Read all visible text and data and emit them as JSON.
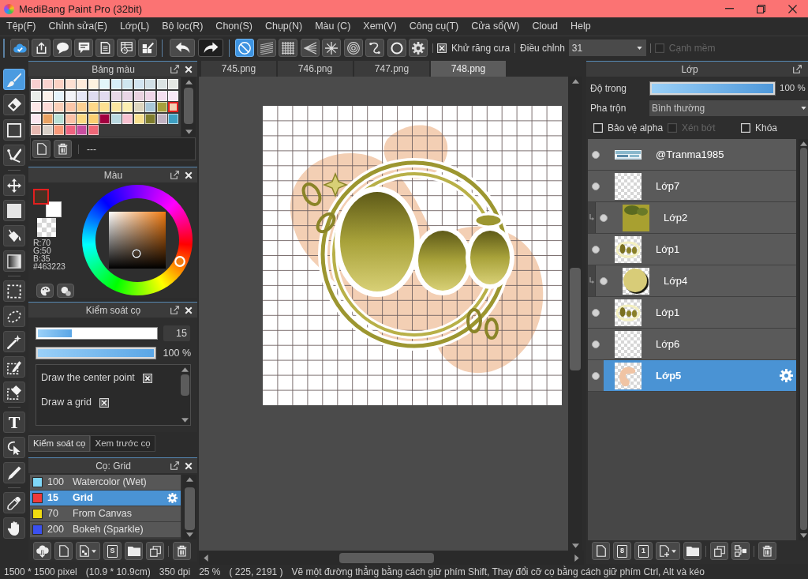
{
  "window": {
    "title": "MediBang Paint Pro (32bit)"
  },
  "menu": [
    "Tệp(F)",
    "Chỉnh sửa(E)",
    "Lớp(L)",
    "Bộ lọc(R)",
    "Chọn(S)",
    "Chụp(N)",
    "Màu (C)",
    "Xem(V)",
    "Công cụ(T)",
    "Cửa sổ(W)",
    "Cloud",
    "Help"
  ],
  "toolbar": {
    "file_buttons": [
      {
        "kind": "cloud"
      },
      {
        "kind": "upload"
      },
      {
        "kind": "speech"
      },
      {
        "kind": "message"
      },
      {
        "kind": "document"
      },
      {
        "kind": "table"
      },
      {
        "kind": "layout"
      }
    ],
    "history_buttons": [
      {
        "kind": "undo"
      },
      {
        "kind": "redo"
      }
    ],
    "snap_buttons": [
      {
        "kind": "off",
        "selected": true
      },
      {
        "kind": "parallel",
        "selected": false
      },
      {
        "kind": "grid",
        "selected": false
      },
      {
        "kind": "perspective",
        "selected": false
      },
      {
        "kind": "radial",
        "selected": false
      },
      {
        "kind": "concentric",
        "selected": false
      },
      {
        "kind": "curve",
        "selected": false
      },
      {
        "kind": "circle",
        "selected": false
      },
      {
        "kind": "settings",
        "selected": false
      }
    ],
    "antialias": {
      "label": "Khử răng cưa",
      "checked": true
    },
    "correction": {
      "label": "Điều chỉnh",
      "value": "31"
    },
    "soft_edge": {
      "label": "Cạnh mềm",
      "checked": false,
      "disabled": true
    }
  },
  "tool_groups": [
    [
      {
        "kind": "brush",
        "selected": true
      },
      {
        "kind": "eraser",
        "selected": false
      },
      {
        "kind": "shape",
        "selected": false
      },
      {
        "kind": "polyline",
        "selected": false
      }
    ],
    [
      {
        "kind": "move",
        "selected": false
      },
      {
        "kind": "fill",
        "selected": false
      },
      {
        "kind": "bucket",
        "selected": false
      },
      {
        "kind": "gradient",
        "selected": false
      }
    ],
    [
      {
        "kind": "select",
        "selected": false
      },
      {
        "kind": "lasso",
        "selected": false
      },
      {
        "kind": "magic-wand",
        "selected": false
      },
      {
        "kind": "select-pen",
        "selected": false
      },
      {
        "kind": "select-eraser",
        "selected": false
      }
    ],
    [
      {
        "kind": "text",
        "label": "T",
        "selected": false
      },
      {
        "kind": "operation",
        "selected": false
      },
      {
        "kind": "divide",
        "selected": false
      }
    ],
    [
      {
        "kind": "eyedropper",
        "selected": false
      },
      {
        "kind": "hand",
        "selected": false
      }
    ]
  ],
  "palette_panel": {
    "title": "Bảng màu",
    "swatches": [
      {
        "color": "#f8cfd0",
        "selected": false
      },
      {
        "color": "#fad3cf",
        "selected": false
      },
      {
        "color": "#fcd2c4",
        "selected": false
      },
      {
        "color": "#fde0d2",
        "selected": false
      },
      {
        "color": "#feebdb",
        "selected": false
      },
      {
        "color": "#fef2e0",
        "selected": false
      },
      {
        "color": "#e2f6f9",
        "selected": false
      },
      {
        "color": "#d6eef8",
        "selected": false
      },
      {
        "color": "#cfe6ef",
        "selected": false
      },
      {
        "color": "#d3e5f1",
        "selected": false
      },
      {
        "color": "#d2e0e6",
        "selected": false
      },
      {
        "color": "#dbe3e3",
        "selected": false
      },
      {
        "color": "#e4e7e3",
        "selected": false
      },
      {
        "color": "#e9ede9",
        "selected": false
      },
      {
        "color": "#fdf1ea",
        "selected": false
      },
      {
        "color": "#e6f3fb",
        "selected": false
      },
      {
        "color": "#f3f3f8",
        "selected": false
      },
      {
        "color": "#e7e8f7",
        "selected": false
      },
      {
        "color": "#dfdcf0",
        "selected": false
      },
      {
        "color": "#e2daf0",
        "selected": false
      },
      {
        "color": "#e8d8e8",
        "selected": false
      },
      {
        "color": "#e9d6e6",
        "selected": false
      },
      {
        "color": "#ead3e0",
        "selected": false
      },
      {
        "color": "#f0d6e8",
        "selected": false
      },
      {
        "color": "#f4dff0",
        "selected": false
      },
      {
        "color": "#f9e9f7",
        "selected": false
      },
      {
        "color": "#fde7e8",
        "selected": false
      },
      {
        "color": "#fbdbd7",
        "selected": false
      },
      {
        "color": "#fbcfb8",
        "selected": false
      },
      {
        "color": "#fbc7a9",
        "selected": false
      },
      {
        "color": "#fcd092",
        "selected": false
      },
      {
        "color": "#fdd888",
        "selected": false
      },
      {
        "color": "#fde091",
        "selected": false
      },
      {
        "color": "#fce7a1",
        "selected": false
      },
      {
        "color": "#fcefb2",
        "selected": false
      },
      {
        "color": "#ddd6bf",
        "selected": false
      },
      {
        "color": "#a9c8d9",
        "selected": false
      },
      {
        "color": "#a6a03d",
        "selected": false
      },
      {
        "color": "#f4d0b2",
        "selected": true
      },
      {
        "color": "#fbe6ef",
        "selected": false
      },
      {
        "color": "#e9a262",
        "selected": false
      },
      {
        "color": "#b9e0d6",
        "selected": false
      },
      {
        "color": "#fbc1a7",
        "selected": false
      },
      {
        "color": "#fcd982",
        "selected": false
      },
      {
        "color": "#fbcf71",
        "selected": false
      },
      {
        "color": "#a2003f",
        "selected": false
      },
      {
        "color": "#b9d8e0",
        "selected": false
      },
      {
        "color": "#f7c1d0",
        "selected": false
      },
      {
        "color": "#f7e08f",
        "selected": false
      },
      {
        "color": "#7f7d2d",
        "selected": false
      },
      {
        "color": "#c0b2c2",
        "selected": false
      },
      {
        "color": "#3e9fc2",
        "selected": false
      },
      {
        "color": "#e7b9b1",
        "selected": false
      },
      {
        "color": "#d9d0c8",
        "selected": false
      },
      {
        "color": "#f89a7a",
        "selected": false
      },
      {
        "color": "#ef6480",
        "selected": false
      },
      {
        "color": "#c84fa0",
        "selected": false
      },
      {
        "color": "#ef6878",
        "selected": false
      }
    ],
    "buttons": [
      {
        "kind": "new"
      },
      {
        "kind": "delete"
      }
    ],
    "set_name": "---"
  },
  "color_panel": {
    "title": "Màu",
    "colors": [
      {
        "kind": "foreground",
        "color": "#463223",
        "selected": true
      },
      {
        "kind": "background",
        "color": "#ffffff",
        "selected": false
      }
    ],
    "readout": [
      "R:70",
      "G:50",
      "B:35",
      "#463223"
    ],
    "buttons": [
      {
        "kind": "palette"
      },
      {
        "kind": "mix"
      }
    ]
  },
  "brush_control_panel": {
    "title": "Kiểm soát cọ",
    "size": {
      "level": 0.29,
      "value": "15"
    },
    "opacity": {
      "level": 1,
      "value": "100 %"
    },
    "options": [
      {
        "label": "Draw the center point",
        "checked": true
      },
      {
        "label": "Draw a grid",
        "checked": true
      }
    ],
    "tabs": [
      {
        "label": "Kiểm soát cọ",
        "selected": true
      },
      {
        "label": "Xem trước cọ",
        "selected": false
      }
    ]
  },
  "brush_panel": {
    "title": "Cọ: Grid",
    "brushes": [
      {
        "color": "#7fd8f8",
        "size": "100",
        "name": "Watercolor (Wet)",
        "selected": false
      },
      {
        "color": "#f03a3a",
        "size": "15",
        "name": "Grid",
        "selected": true
      },
      {
        "color": "#f0dc10",
        "size": "70",
        "name": "From Canvas",
        "selected": false
      },
      {
        "color": "#3a50f0",
        "size": "200",
        "name": "Bokeh (Sparkle)",
        "selected": false
      }
    ],
    "buttons": [
      [
        {
          "kind": "cloud-download"
        },
        {
          "kind": "new"
        },
        {
          "kind": "add-brush-menu"
        },
        {
          "kind": "script",
          "label": "S"
        },
        {
          "kind": "folder"
        },
        {
          "kind": "duplicate"
        }
      ],
      [
        {
          "kind": "delete"
        }
      ]
    ]
  },
  "document_tabs": [
    {
      "label": "745.png",
      "selected": false
    },
    {
      "label": "746.png",
      "selected": false
    },
    {
      "label": "747.png",
      "selected": false
    },
    {
      "label": "748.png",
      "selected": true
    }
  ],
  "layer_panel": {
    "title": "Lớp",
    "opacity": {
      "label": "Độ trong",
      "level": 1,
      "value": "100 %"
    },
    "blend": {
      "label": "Pha trộn",
      "value": "Bình thường"
    },
    "options": [
      {
        "label": "Bảo vệ alpha",
        "checked": false,
        "disabled": false
      },
      {
        "label": "Xén bớt",
        "checked": false,
        "disabled": true
      },
      {
        "label": "Khóa",
        "checked": false,
        "disabled": false
      }
    ],
    "layers": [
      {
        "name": "@Tranma1985",
        "kind": "text",
        "visible": true,
        "clipped": false,
        "selected": false
      },
      {
        "name": "Lớp7",
        "kind": "empty",
        "visible": true,
        "clipped": false,
        "selected": false
      },
      {
        "name": "Lớp2",
        "kind": "fill",
        "visible": true,
        "clipped": true,
        "selected": false
      },
      {
        "name": "Lớp1",
        "kind": "lettering",
        "visible": true,
        "clipped": false,
        "selected": false
      },
      {
        "name": "Lớp4",
        "kind": "disc",
        "visible": true,
        "clipped": true,
        "selected": false
      },
      {
        "name": "Lớp1",
        "kind": "lettering",
        "visible": true,
        "clipped": false,
        "selected": false
      },
      {
        "name": "Lớp6",
        "kind": "empty",
        "visible": true,
        "clipped": false,
        "selected": false
      },
      {
        "name": "Lớp5",
        "kind": "blob",
        "visible": true,
        "clipped": false,
        "selected": true
      }
    ],
    "buttons": [
      [
        {
          "kind": "new"
        },
        {
          "kind": "new-8bit",
          "label": "8"
        },
        {
          "kind": "new-1bit",
          "label": "1"
        },
        {
          "kind": "add-layer-menu"
        },
        {
          "kind": "folder"
        }
      ],
      [
        {
          "kind": "duplicate"
        },
        {
          "kind": "merge"
        }
      ],
      [
        {
          "kind": "delete"
        }
      ]
    ]
  },
  "status_bar": [
    "1500 * 1500 pixel",
    "(10.9 * 10.9cm)",
    "350 dpi",
    "25 %",
    "( 225, 2191 )",
    "Vẽ một đường thẳng bằng cách giữ phím Shift, Thay đổi cỡ cọ bằng cách giữ phím Ctrl, Alt và kéo"
  ]
}
